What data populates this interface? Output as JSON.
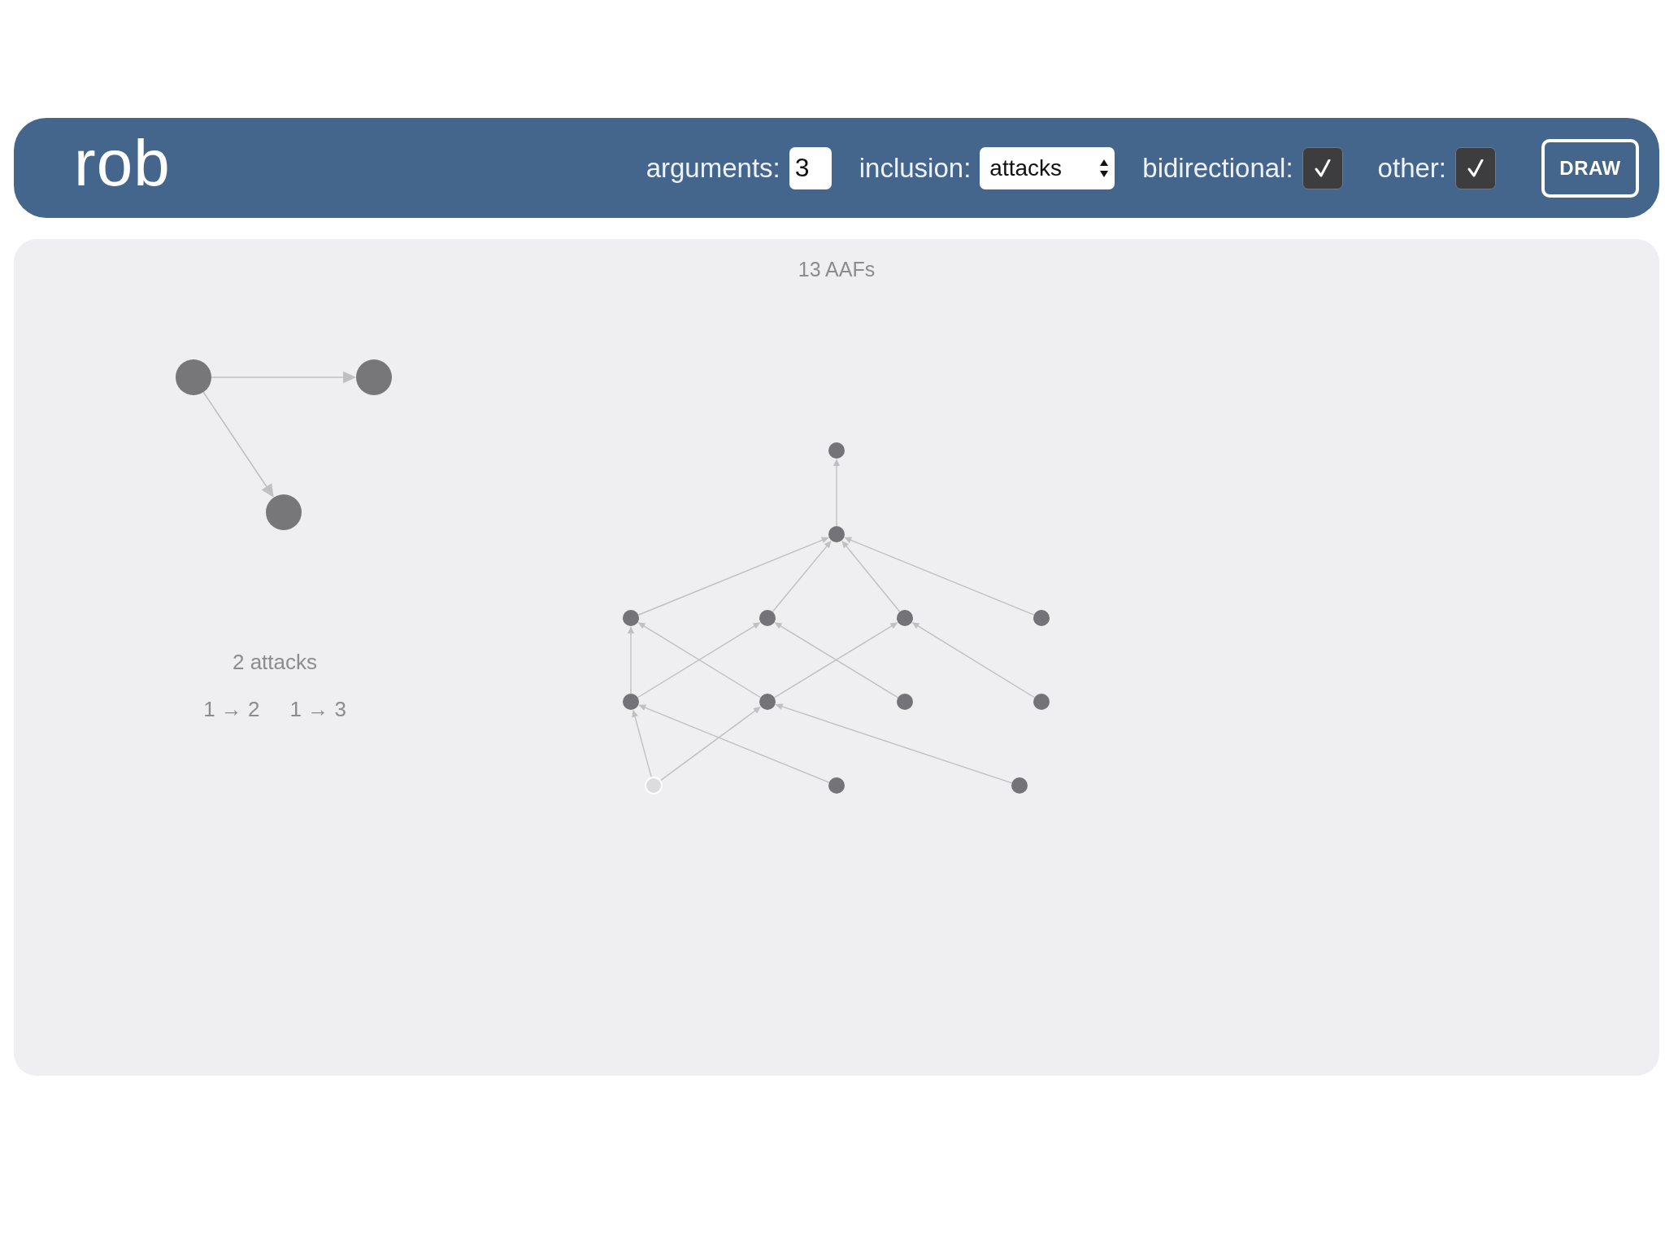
{
  "header": {
    "logo": "rob",
    "arguments": {
      "label": "arguments:",
      "value": "3"
    },
    "inclusion": {
      "label": "inclusion:",
      "value": "attacks"
    },
    "bidirectional": {
      "label": "bidirectional:",
      "checked": true
    },
    "other": {
      "label": "other:",
      "checked": true
    },
    "draw_button": "DRAW"
  },
  "results": {
    "title": "13 AAFs",
    "selected_framework": {
      "attack_count": "2 attacks",
      "attacks": [
        "1 → 2",
        "1 → 3"
      ]
    },
    "lattice": {
      "levels": [
        [
          {
            "selected": false
          }
        ],
        [
          {
            "selected": false
          }
        ],
        [
          {
            "selected": false
          },
          {
            "selected": false
          },
          {
            "selected": false
          },
          {
            "selected": false
          }
        ],
        [
          {
            "selected": false
          },
          {
            "selected": false
          },
          {
            "selected": false
          },
          {
            "selected": false
          }
        ],
        [
          {
            "selected": true
          },
          {
            "selected": false
          },
          {
            "selected": false
          }
        ]
      ]
    }
  }
}
